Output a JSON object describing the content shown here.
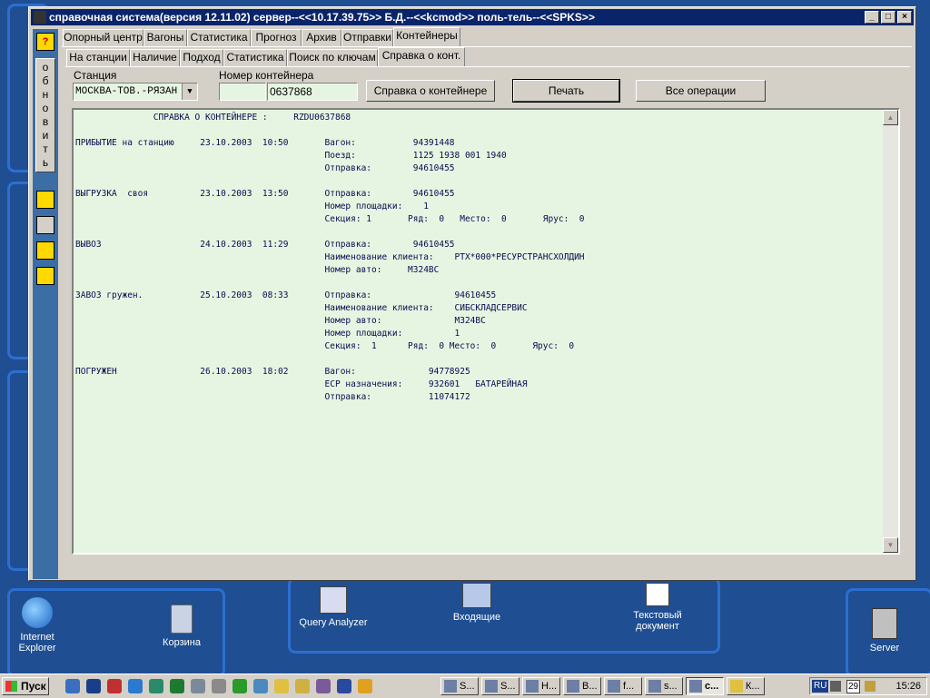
{
  "desktop": {
    "icons": [
      {
        "label": "Internet Explorer",
        "icon": "ie-icon"
      },
      {
        "label": "Корзина",
        "icon": "recycle-bin-icon"
      },
      {
        "label": "Query Analyzer",
        "icon": "query-analyzer-icon"
      },
      {
        "label": "Входящие",
        "icon": "inbox-icon"
      },
      {
        "label": "Текстовый документ",
        "icon": "text-document-icon"
      },
      {
        "label": "Server",
        "icon": "server-icon"
      }
    ]
  },
  "window": {
    "title": "справочная система(версия 12.11.02) сервер--<<10.17.39.75>> Б.Д.--<<kcmod>> поль-тель--<<SPKS>>",
    "buttons": {
      "minimize": "_",
      "maximize": "□",
      "close": "×"
    }
  },
  "sidebar": {
    "help": "?",
    "refresh_label": "о\nб\nн\nо\nв\nи\nт\nь"
  },
  "tabs_top": [
    "Опорный центр",
    "Вагоны",
    "Статистика",
    "Прогноз",
    "Архив",
    "Отправки",
    "Контейнеры"
  ],
  "tabs_sub": [
    "На станции",
    "Наличие",
    "Подход",
    "Статистика",
    "Поиск по ключам",
    "Справка о конт."
  ],
  "form": {
    "station_label": "Станция",
    "station_value": "МОСКВА-ТОВ.-РЯЗАН",
    "container_label": "Номер контейнера",
    "container_prefix": "",
    "container_number": "0637868",
    "btn_info": "Справка о контейнере",
    "btn_print": "Печать",
    "btn_all": "Все операции"
  },
  "report": {
    "text": "               СПРАВКА О КОНТЕЙНЕРЕ :     RZDU0637868\n\nПРИБЫТИЕ на станцию     23.10.2003  10:50       Вагон:           94391448\n                                                Поезд:           1125 1938 001 1940\n                                                Отправка:        94610455\n\nВЫГРУЗКА  своя          23.10.2003  13:50       Отправка:        94610455\n                                                Номер площадки:    1\n                                                Секция: 1       Ряд:  0   Место:  0       Ярус:  0\n\nВЫВОЗ                   24.10.2003  11:29       Отправка:        94610455\n                                                Наименование клиента:    РТХ*000*РЕСУРСТРАНСХОЛДИН\n                                                Номер авто:     М324ВС\n\nЗАВОЗ гружен.           25.10.2003  08:33       Отправка:                94610455\n                                                Наименование клиента:    СИБСКЛАДСЕРВИС\n                                                Номер авто:              М324ВС\n                                                Номер площадки:          1\n                                                Секция:  1      Ряд:  0 Место:  0       Ярус:  0\n\nПОГРУЖЕН                26.10.2003  18:02       Вагон:              94778925\n                                                ЕСР назначения:     932601   БАТАРЕЙНАЯ\n                                                Отправка:           11074172"
  },
  "taskbar": {
    "start": "Пуск",
    "tasks": [
      "S...",
      "S...",
      "Н...",
      "В...",
      "f...",
      "s...",
      "с...",
      "К..."
    ],
    "lang": "RU",
    "day": "29",
    "clock": "15:26"
  },
  "colors": {
    "desktop": "#1f4e92",
    "titlebar": "#0a246a",
    "report_bg": "#e5f5e1",
    "toolbar": "#3b6ea5"
  }
}
